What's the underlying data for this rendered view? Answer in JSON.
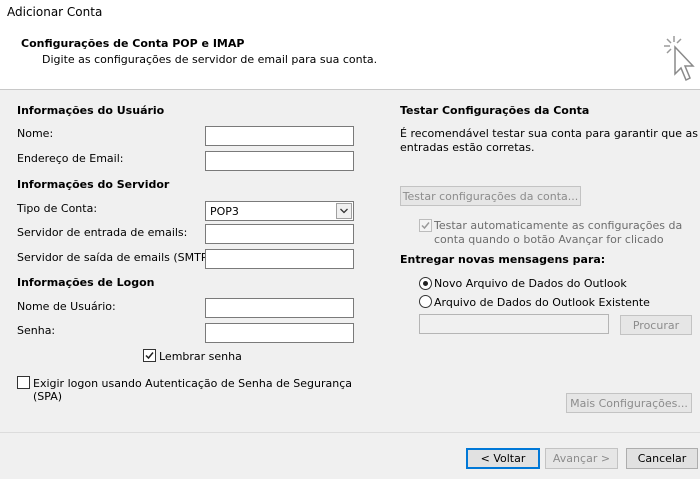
{
  "window": {
    "title": "Adicionar Conta"
  },
  "header": {
    "title": "Configurações de Conta POP e IMAP",
    "subtitle": "Digite as configurações de servidor de email para sua conta."
  },
  "user_info": {
    "section": "Informações do Usuário",
    "name_label": "Nome:",
    "name_value": "",
    "email_label": "Endereço de Email:",
    "email_value": ""
  },
  "server_info": {
    "section": "Informações do Servidor",
    "account_type_label": "Tipo de Conta:",
    "account_type_value": "POP3",
    "incoming_label": "Servidor de entrada de emails:",
    "incoming_value": "",
    "outgoing_label": "Servidor de saída de emails (SMTP):",
    "outgoing_value": ""
  },
  "logon_info": {
    "section": "Informações de Logon",
    "username_label": "Nome de Usuário:",
    "username_value": "",
    "password_label": "Senha:",
    "password_value": "",
    "remember_label": "Lembrar senha",
    "remember_checked": true,
    "spa_label_line1": "Exigir logon usando Autenticação de Senha de Segurança",
    "spa_label_line2": "(SPA)",
    "spa_checked": false
  },
  "test": {
    "section": "Testar Configurações da Conta",
    "desc_line1": "É recomendável testar sua conta para garantir que as",
    "desc_line2": "entradas estão corretas.",
    "test_button": "Testar configurações da conta...",
    "auto_test_line1": "Testar automaticamente as configurações da",
    "auto_test_line2": "conta quando o botão Avançar for clicado",
    "auto_test_checked": true
  },
  "delivery": {
    "section": "Entregar novas mensagens para:",
    "option_new": "Novo Arquivo de Dados do Outlook",
    "option_existing": "Arquivo de Dados do Outlook Existente",
    "selected": "new",
    "path_value": "",
    "browse_button": "Procurar"
  },
  "more_settings_button": "Mais Configurações...",
  "footer": {
    "back_button": "< Voltar",
    "next_button": "Avançar >",
    "cancel_button": "Cancelar"
  },
  "colors": {
    "accent": "#0078d7",
    "background": "#f0f0f0",
    "header": "#ffffff"
  }
}
